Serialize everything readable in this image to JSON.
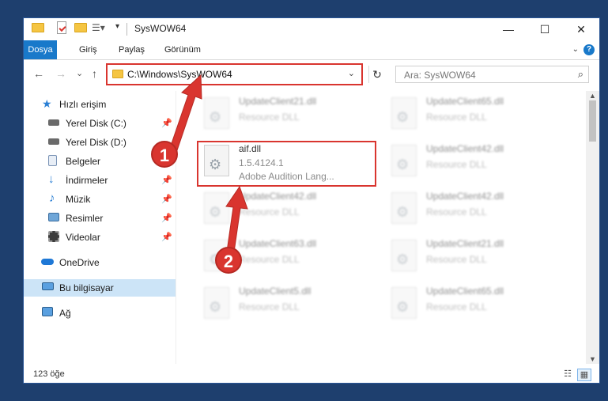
{
  "window": {
    "title": "SysWOW64",
    "caption": {
      "minimize": "—",
      "maximize": "☐",
      "close": "✕"
    }
  },
  "ribbon": {
    "tabs": [
      "Dosya",
      "Giriş",
      "Paylaş",
      "Görünüm"
    ],
    "help": "?"
  },
  "nav": {
    "back": "←",
    "forward": "→",
    "recent": "⌄",
    "up": "↑",
    "address": "C:\\Windows\\SysWOW64",
    "address_chevron": "⌄",
    "refresh": "↻",
    "search_placeholder": "Ara: SysWOW64",
    "search_icon": "⌕"
  },
  "sidebar": {
    "items": [
      {
        "label": "Hızlı erişim",
        "icon": "star-icon",
        "pinned": false
      },
      {
        "label": "Yerel Disk (C:)",
        "icon": "drive-icon",
        "pinned": true
      },
      {
        "label": "Yerel Disk (D:)",
        "icon": "drive-icon",
        "pinned": false
      },
      {
        "label": "Belgeler",
        "icon": "documents-icon",
        "pinned": true
      },
      {
        "label": "İndirmeler",
        "icon": "download-icon",
        "pinned": true
      },
      {
        "label": "Müzik",
        "icon": "music-icon",
        "pinned": true
      },
      {
        "label": "Resimler",
        "icon": "pictures-icon",
        "pinned": true
      },
      {
        "label": "Videolar",
        "icon": "videos-icon",
        "pinned": true
      },
      {
        "label": "OneDrive",
        "icon": "cloud-icon",
        "pinned": false
      },
      {
        "label": "Bu bilgisayar",
        "icon": "computer-icon",
        "pinned": false,
        "selected": true
      },
      {
        "label": "Ağ",
        "icon": "network-icon",
        "pinned": false
      }
    ],
    "pin_glyph": "📌"
  },
  "files": {
    "highlighted": {
      "name": "aif.dll",
      "version": "1.5.4124.1",
      "description": "Adobe Audition Lang..."
    },
    "blurred": [
      {
        "name": "UpdateClient21.dll",
        "type": "Resource DLL"
      },
      {
        "name": "UpdateClient65.dll",
        "type": "Resource DLL"
      },
      {
        "name": "UpdateClient42.dll",
        "type": "Resource DLL"
      },
      {
        "name": "UpdateClient42.dll",
        "type": "Resource DLL"
      },
      {
        "name": "UpdateClient42.dll",
        "type": "Resource DLL"
      },
      {
        "name": "UpdateClient63.dll",
        "type": "Resource DLL"
      },
      {
        "name": "UpdateClient21.dll",
        "type": "Resource DLL"
      },
      {
        "name": "UpdateClient5.dll",
        "type": "Resource DLL"
      },
      {
        "name": "UpdateClient65.dll",
        "type": "Resource DLL"
      }
    ]
  },
  "status": {
    "count": "123 öğe"
  },
  "annotations": {
    "step1": "1",
    "step2": "2",
    "color": "#d9352f"
  }
}
